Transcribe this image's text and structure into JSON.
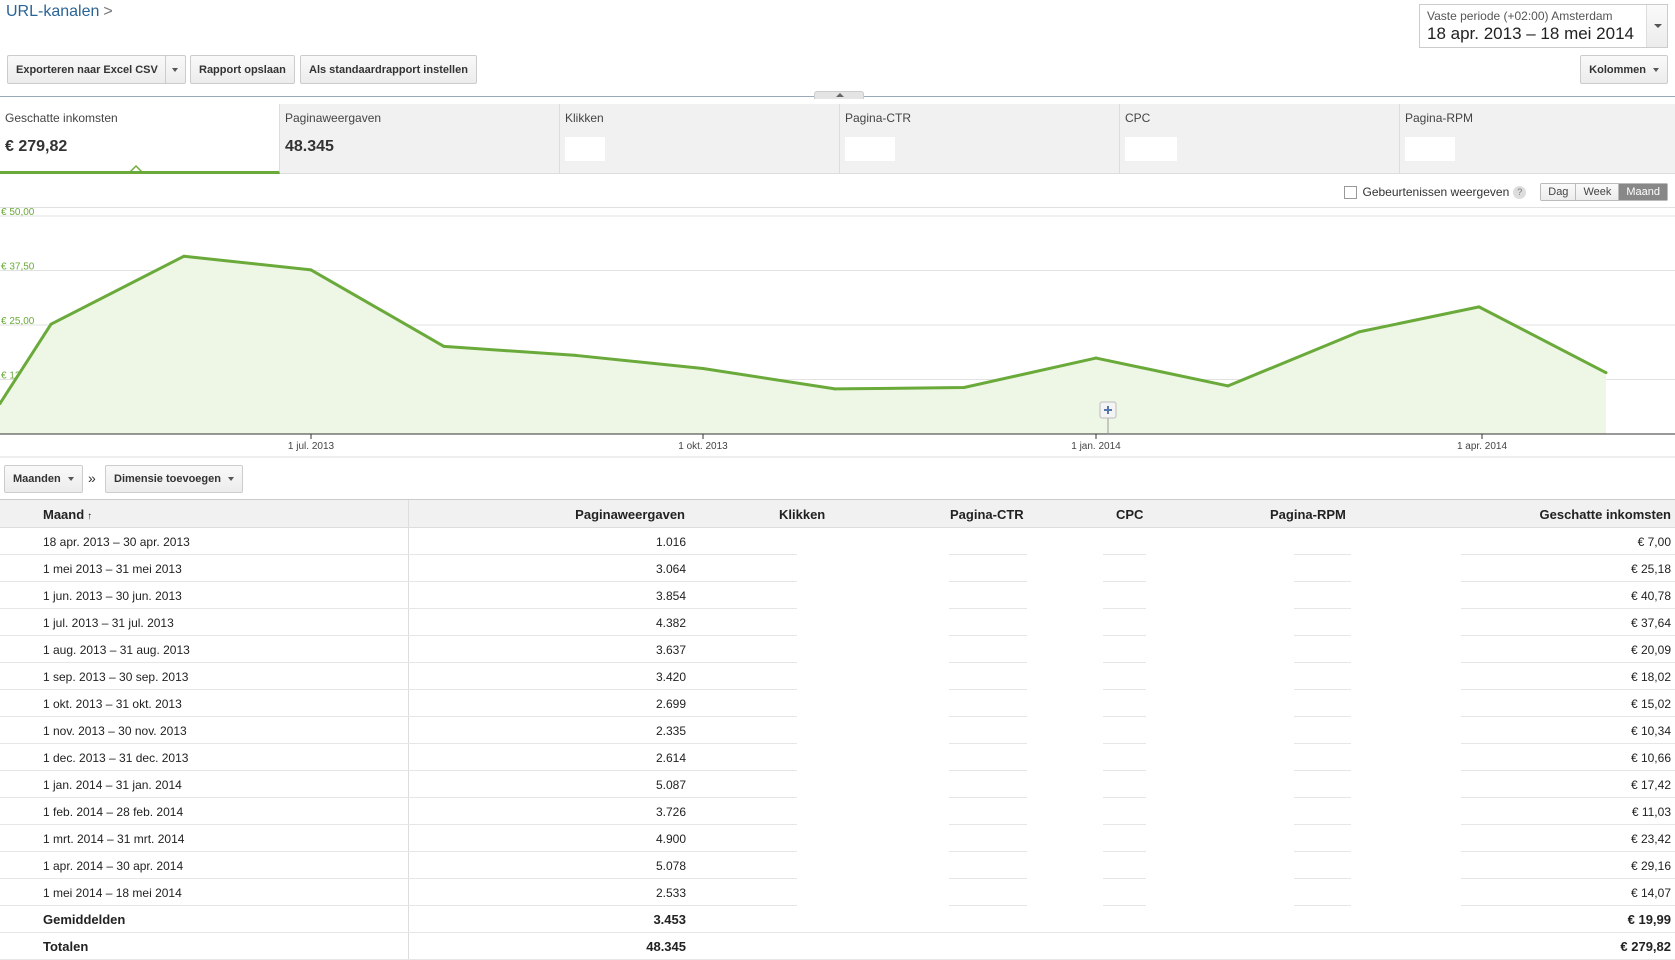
{
  "breadcrumb": {
    "title": "URL-kanalen",
    "separator": ">"
  },
  "date_range": {
    "label": "Vaste periode (+02:00) Amsterdam",
    "value": "18 apr. 2013 – 18 mei 2014"
  },
  "toolbar": {
    "export_label": "Exporteren naar Excel CSV",
    "save_label": "Rapport opslaan",
    "default_label": "Als standaardrapport instellen",
    "columns_label": "Kolommen"
  },
  "metrics": [
    {
      "label": "Geschatte inkomsten",
      "value": "€ 279,82"
    },
    {
      "label": "Paginaweergaven",
      "value": "48.345"
    },
    {
      "label": "Klikken",
      "value": ""
    },
    {
      "label": "Pagina-CTR",
      "value": ""
    },
    {
      "label": "CPC",
      "value": ""
    },
    {
      "label": "Pagina-RPM",
      "value": ""
    }
  ],
  "chart_controls": {
    "events_label": "Gebeurtenissen weergeven",
    "help_glyph": "?",
    "granularity": [
      "Dag",
      "Week",
      "Maand"
    ],
    "selected": "Maand"
  },
  "chart_data": {
    "type": "area",
    "x": [
      "2013-04",
      "2013-05",
      "2013-06",
      "2013-07",
      "2013-08",
      "2013-09",
      "2013-10",
      "2013-11",
      "2013-12",
      "2014-01",
      "2014-02",
      "2014-03",
      "2014-04",
      "2014-05"
    ],
    "series": [
      {
        "values": [
          7.0,
          25.18,
          40.78,
          37.64,
          20.09,
          18.02,
          15.02,
          10.34,
          10.66,
          17.42,
          11.03,
          23.42,
          29.16,
          14.07
        ]
      }
    ],
    "y_ticks": [
      "€ 12,50",
      "€ 25,00",
      "€ 37,50",
      "€ 50,00"
    ],
    "y_tick_values": [
      12.5,
      25,
      37.5,
      50
    ],
    "ylim": [
      0,
      50
    ],
    "x_tick_labels": [
      "1 jul. 2013",
      "1 okt. 2013",
      "1 jan. 2014",
      "1 apr. 2014"
    ],
    "grid": true,
    "color": "#6aaa3a",
    "fill": "#eef6e6"
  },
  "table_toolbar": {
    "dimension_label": "Maanden",
    "separator": "»",
    "add_dimension_label": "Dimensie toevoegen"
  },
  "table": {
    "columns": [
      "Maand",
      "Paginaweergaven",
      "Klikken",
      "Pagina-CTR",
      "CPC",
      "Pagina-RPM",
      "Geschatte inkomsten"
    ],
    "sort_indicator": "↑",
    "rows": [
      {
        "month": "18 apr. 2013 – 30 apr. 2013",
        "pageviews": "1.016",
        "earnings": "€ 7,00"
      },
      {
        "month": "1 mei 2013 – 31 mei 2013",
        "pageviews": "3.064",
        "earnings": "€ 25,18"
      },
      {
        "month": "1 jun. 2013 – 30 jun. 2013",
        "pageviews": "3.854",
        "earnings": "€ 40,78"
      },
      {
        "month": "1 jul. 2013 – 31 jul. 2013",
        "pageviews": "4.382",
        "earnings": "€ 37,64"
      },
      {
        "month": "1 aug. 2013 – 31 aug. 2013",
        "pageviews": "3.637",
        "earnings": "€ 20,09"
      },
      {
        "month": "1 sep. 2013 – 30 sep. 2013",
        "pageviews": "3.420",
        "earnings": "€ 18,02"
      },
      {
        "month": "1 okt. 2013 – 31 okt. 2013",
        "pageviews": "2.699",
        "earnings": "€ 15,02"
      },
      {
        "month": "1 nov. 2013 – 30 nov. 2013",
        "pageviews": "2.335",
        "earnings": "€ 10,34"
      },
      {
        "month": "1 dec. 2013 – 31 dec. 2013",
        "pageviews": "2.614",
        "earnings": "€ 10,66"
      },
      {
        "month": "1 jan. 2014 – 31 jan. 2014",
        "pageviews": "5.087",
        "earnings": "€ 17,42"
      },
      {
        "month": "1 feb. 2014 – 28 feb. 2014",
        "pageviews": "3.726",
        "earnings": "€ 11,03"
      },
      {
        "month": "1 mrt. 2014 – 31 mrt. 2014",
        "pageviews": "4.900",
        "earnings": "€ 23,42"
      },
      {
        "month": "1 apr. 2014 – 30 apr. 2014",
        "pageviews": "5.078",
        "earnings": "€ 29,16"
      },
      {
        "month": "1 mei 2014 – 18 mei 2014",
        "pageviews": "2.533",
        "earnings": "€ 14,07"
      }
    ],
    "averages": {
      "label": "Gemiddelden",
      "pageviews": "3.453",
      "earnings": "€ 19,99"
    },
    "totals": {
      "label": "Totalen",
      "pageviews": "48.345",
      "earnings": "€ 279,82"
    }
  }
}
